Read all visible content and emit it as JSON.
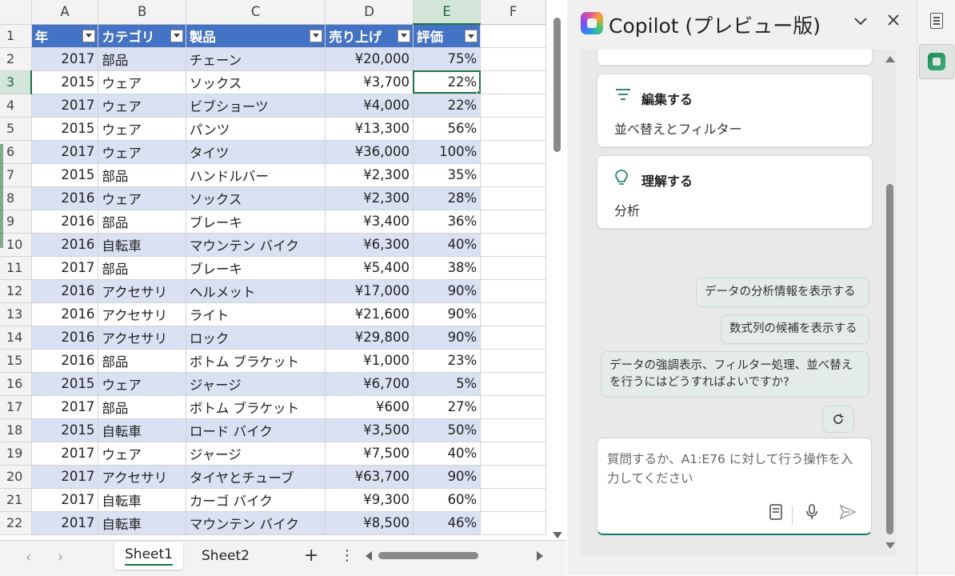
{
  "sheet": {
    "columns": [
      "A",
      "B",
      "C",
      "D",
      "E",
      "F"
    ],
    "selected_column": "E",
    "selected_row": 3,
    "headers": [
      "年",
      "カテゴリ",
      "製品",
      "売り上げ",
      "評価"
    ],
    "rows": [
      {
        "num": "2",
        "year": "2017",
        "category": "部品",
        "product": "チェーン",
        "sales": "¥20,000",
        "rating": "75%"
      },
      {
        "num": "3",
        "year": "2015",
        "category": "ウェア",
        "product": "ソックス",
        "sales": "¥3,700",
        "rating": "22%"
      },
      {
        "num": "4",
        "year": "2017",
        "category": "ウェア",
        "product": "ビブショーツ",
        "sales": "¥4,000",
        "rating": "22%"
      },
      {
        "num": "5",
        "year": "2015",
        "category": "ウェア",
        "product": "パンツ",
        "sales": "¥13,300",
        "rating": "56%"
      },
      {
        "num": "6",
        "year": "2017",
        "category": "ウェア",
        "product": "タイツ",
        "sales": "¥36,000",
        "rating": "100%"
      },
      {
        "num": "7",
        "year": "2015",
        "category": "部品",
        "product": "ハンドルバー",
        "sales": "¥2,300",
        "rating": "35%"
      },
      {
        "num": "8",
        "year": "2016",
        "category": "ウェア",
        "product": "ソックス",
        "sales": "¥2,300",
        "rating": "28%"
      },
      {
        "num": "9",
        "year": "2016",
        "category": "部品",
        "product": "ブレーキ",
        "sales": "¥3,400",
        "rating": "36%"
      },
      {
        "num": "10",
        "year": "2016",
        "category": "自転車",
        "product": "マウンテン バイク",
        "sales": "¥6,300",
        "rating": "40%"
      },
      {
        "num": "11",
        "year": "2017",
        "category": "部品",
        "product": "ブレーキ",
        "sales": "¥5,400",
        "rating": "38%"
      },
      {
        "num": "12",
        "year": "2016",
        "category": "アクセサリ",
        "product": "ヘルメット",
        "sales": "¥17,000",
        "rating": "90%"
      },
      {
        "num": "13",
        "year": "2016",
        "category": "アクセサリ",
        "product": "ライト",
        "sales": "¥21,600",
        "rating": "90%"
      },
      {
        "num": "14",
        "year": "2016",
        "category": "アクセサリ",
        "product": "ロック",
        "sales": "¥29,800",
        "rating": "90%"
      },
      {
        "num": "15",
        "year": "2016",
        "category": "部品",
        "product": "ボトム ブラケット",
        "sales": "¥1,000",
        "rating": "23%"
      },
      {
        "num": "16",
        "year": "2015",
        "category": "ウェア",
        "product": "ジャージ",
        "sales": "¥6,700",
        "rating": "5%"
      },
      {
        "num": "17",
        "year": "2017",
        "category": "部品",
        "product": "ボトム ブラケット",
        "sales": "¥600",
        "rating": "27%"
      },
      {
        "num": "18",
        "year": "2015",
        "category": "自転車",
        "product": "ロード バイク",
        "sales": "¥3,500",
        "rating": "50%"
      },
      {
        "num": "19",
        "year": "2017",
        "category": "ウェア",
        "product": "ジャージ",
        "sales": "¥7,500",
        "rating": "40%"
      },
      {
        "num": "20",
        "year": "2017",
        "category": "アクセサリ",
        "product": "タイヤとチューブ",
        "sales": "¥63,700",
        "rating": "90%"
      },
      {
        "num": "21",
        "year": "2017",
        "category": "自転車",
        "product": "カーゴ バイク",
        "sales": "¥9,300",
        "rating": "60%"
      },
      {
        "num": "22",
        "year": "2017",
        "category": "自転車",
        "product": "マウンテン バイク",
        "sales": "¥8,500",
        "rating": "46%"
      }
    ]
  },
  "tabs": {
    "sheets": [
      "Sheet1",
      "Sheet2"
    ],
    "active": "Sheet1",
    "add_label": "+",
    "more_label": "⋮",
    "prev_label": "‹",
    "next_label": "›"
  },
  "copilot": {
    "title": "Copilot (プレビュー版)",
    "cards": [
      {
        "title": "編集する",
        "subtitle": "並べ替えとフィルター",
        "icon": "filter-lines-icon"
      },
      {
        "title": "理解する",
        "subtitle": "分析",
        "icon": "lightbulb-icon"
      }
    ],
    "suggestions": [
      "データの分析情報を表示する",
      "数式列の候補を表示する",
      "データの強調表示、フィルター処理、並べ替えを行うにはどうすればよいですか?"
    ],
    "input_placeholder": "質問するか、A1:E76 に対して行う操作を入力してください",
    "accent_color": "#117865"
  },
  "colors": {
    "table_header": "#4472c4",
    "table_band": "#d9e1f2",
    "selection": "#217346"
  }
}
